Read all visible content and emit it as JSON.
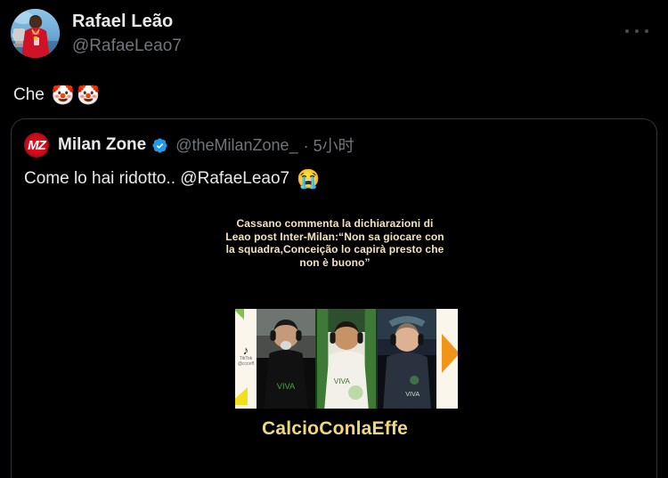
{
  "app": {
    "background": "#000000",
    "text_color": "#e7e9ea",
    "muted_color": "#71767b",
    "accent_blue": "#1d9bf0",
    "border_color": "#2f3336"
  },
  "tweet": {
    "author": {
      "display_name": "Rafael Leão",
      "handle": "@RafaeLeao7",
      "avatar_alt": "footballer-holding-trophy"
    },
    "text": "Che",
    "emojis": [
      "🤡",
      "🤡"
    ],
    "more_menu_label": "···"
  },
  "quoted_tweet": {
    "author": {
      "display_name": "Milan Zone",
      "handle": "@theMilanZone_",
      "logo_text": "MZ",
      "logo_color": "#d90d1b",
      "verified": true,
      "verified_color": "#1d9bf0"
    },
    "timestamp": "· 5小时",
    "text": "Come lo hai ridotto.. @RafaeLeao7",
    "emoji": "😭",
    "media": {
      "type": "video-thumbnail",
      "caption": "Cassano commenta la dichiarazioni di Leao post Inter-Milan:“Non sa giocare con la squadra,Conceição lo capirà presto che non è buono”",
      "caption_color": "#f3e4c0",
      "title": "CalcioConlaEffe",
      "title_color": "#f0d878",
      "watermark": "TikTok",
      "watermark_subtext": "@ccceff",
      "participants": 3
    }
  }
}
